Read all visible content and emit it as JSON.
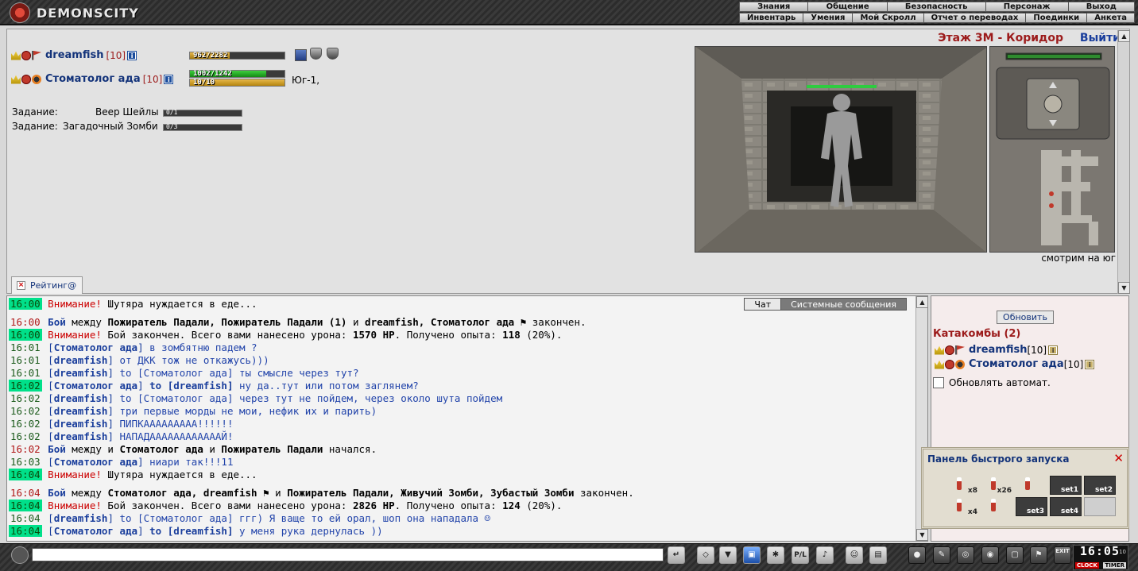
{
  "brand": "DEMONSCITY",
  "menu": {
    "row1": [
      "Знания",
      "Общение",
      "Безопасность",
      "Персонаж",
      "Выход"
    ],
    "row2": [
      "Инвентарь",
      "Умения",
      "Мой Скролл",
      "Отчет о переводах",
      "Поединки",
      "Анкета"
    ]
  },
  "location": {
    "title": "Этаж 3М - Коридор",
    "exit": "Выйти",
    "looking": "смотрим на юг"
  },
  "players": [
    {
      "name": "dreamfish",
      "level": "[10]",
      "hp": "962/2282",
      "hp_frac": 0.42
    },
    {
      "name": "Стоматолог ада",
      "level": "[10]",
      "hp": "1002/1242",
      "hp_frac": 0.81,
      "mp": "10/10",
      "mp_frac": 1.0,
      "direction": "Юг-1,"
    }
  ],
  "tasks": [
    {
      "label": "Задание:",
      "name": "Веер Шейлы",
      "progress": "0/1"
    },
    {
      "label": "Задание:",
      "name": "Загадочный Зомби",
      "progress": "0/3"
    }
  ],
  "tab": {
    "label": "Рейтинг@",
    "close": "×"
  },
  "chat_tabs": {
    "chat": "Чат",
    "system": "Системные сообщения"
  },
  "chat": [
    {
      "time": "16:00",
      "hl": true,
      "parts": [
        {
          "c": "warn",
          "t": "Внимание!"
        },
        {
          "c": "sys",
          "t": " Шутяра нуждается в еде..."
        }
      ]
    },
    {
      "time": "16:00",
      "hl": false,
      "tred": true,
      "gap": true,
      "parts": [
        {
          "c": "link bold",
          "t": "Бой"
        },
        {
          "c": "sys",
          "t": " между "
        },
        {
          "c": "sys bold",
          "t": "Пожиратель Падали, Пожиратель Падали (1)"
        },
        {
          "c": "sys",
          "t": " и "
        },
        {
          "c": "sys bold",
          "t": "dreamfish, Стоматолог ада"
        },
        {
          "c": "sys",
          "t": " ⚑ закончен."
        }
      ]
    },
    {
      "time": "16:00",
      "hl": true,
      "parts": [
        {
          "c": "warn",
          "t": "Внимание!"
        },
        {
          "c": "sys",
          "t": " Бой закончен. Всего вами нанесено урона: "
        },
        {
          "c": "sys bold",
          "t": "1570 HP"
        },
        {
          "c": "sys",
          "t": ". Получено опыта: "
        },
        {
          "c": "sys bold",
          "t": "118"
        },
        {
          "c": "sys",
          "t": " (20%)."
        }
      ]
    },
    {
      "time": "16:01",
      "hl": false,
      "parts": [
        {
          "c": "priv",
          "t": "["
        },
        {
          "c": "priv bold",
          "t": "Стоматолог ада"
        },
        {
          "c": "priv",
          "t": "]"
        },
        {
          "c": "msg",
          "t": " в зомбятню падем ?"
        }
      ]
    },
    {
      "time": "16:01",
      "hl": false,
      "parts": [
        {
          "c": "priv",
          "t": "["
        },
        {
          "c": "priv bold",
          "t": "dreamfish"
        },
        {
          "c": "priv",
          "t": "]"
        },
        {
          "c": "msg",
          "t": " от ДКК тож не откажусь)))"
        }
      ]
    },
    {
      "time": "16:01",
      "hl": false,
      "parts": [
        {
          "c": "priv",
          "t": "["
        },
        {
          "c": "priv bold",
          "t": "dreamfish"
        },
        {
          "c": "priv",
          "t": "]"
        },
        {
          "c": "msg",
          "t": " to [Стоматолог ада] ты смысле через тут?"
        }
      ]
    },
    {
      "time": "16:02",
      "hl": true,
      "parts": [
        {
          "c": "priv",
          "t": "["
        },
        {
          "c": "priv bold",
          "t": "Стоматолог ада"
        },
        {
          "c": "priv",
          "t": "] "
        },
        {
          "c": "priv bold",
          "t": "to [dreamfish]"
        },
        {
          "c": "msg",
          "t": " ну да..тут или потом заглянем?"
        }
      ]
    },
    {
      "time": "16:02",
      "hl": false,
      "parts": [
        {
          "c": "priv",
          "t": "["
        },
        {
          "c": "priv bold",
          "t": "dreamfish"
        },
        {
          "c": "priv",
          "t": "]"
        },
        {
          "c": "msg",
          "t": " to [Стоматолог ада] через тут не пойдем, через около шута пойдем"
        }
      ]
    },
    {
      "time": "16:02",
      "hl": false,
      "parts": [
        {
          "c": "priv",
          "t": "["
        },
        {
          "c": "priv bold",
          "t": "dreamfish"
        },
        {
          "c": "priv",
          "t": "]"
        },
        {
          "c": "msg",
          "t": " три первые морды не мои, нефик их и парить)"
        }
      ]
    },
    {
      "time": "16:02",
      "hl": false,
      "parts": [
        {
          "c": "priv",
          "t": "["
        },
        {
          "c": "priv bold",
          "t": "dreamfish"
        },
        {
          "c": "priv",
          "t": "]"
        },
        {
          "c": "msg",
          "t": " ПИПКААААААААА!!!!!!"
        }
      ]
    },
    {
      "time": "16:02",
      "hl": false,
      "parts": [
        {
          "c": "priv",
          "t": "["
        },
        {
          "c": "priv bold",
          "t": "dreamfish"
        },
        {
          "c": "priv",
          "t": "]"
        },
        {
          "c": "msg",
          "t": " НАПАДААААААААААААЙ!"
        }
      ]
    },
    {
      "time": "16:02",
      "hl": false,
      "tred": true,
      "parts": [
        {
          "c": "link bold",
          "t": "Бой"
        },
        {
          "c": "sys",
          "t": " между и "
        },
        {
          "c": "sys bold",
          "t": "Стоматолог ада"
        },
        {
          "c": "sys",
          "t": " и "
        },
        {
          "c": "sys bold",
          "t": "Пожиратель Падали"
        },
        {
          "c": "sys",
          "t": " начался."
        }
      ]
    },
    {
      "time": "16:03",
      "hl": false,
      "parts": [
        {
          "c": "priv",
          "t": "["
        },
        {
          "c": "priv bold",
          "t": "Стоматолог ада"
        },
        {
          "c": "priv",
          "t": "]"
        },
        {
          "c": "msg",
          "t": " ниари так!!!11"
        }
      ]
    },
    {
      "time": "16:04",
      "hl": true,
      "parts": [
        {
          "c": "warn",
          "t": "Внимание!"
        },
        {
          "c": "sys",
          "t": " Шутяра нуждается в еде..."
        }
      ]
    },
    {
      "time": "16:04",
      "hl": false,
      "tred": true,
      "gap": true,
      "parts": [
        {
          "c": "link bold",
          "t": "Бой"
        },
        {
          "c": "sys",
          "t": " между "
        },
        {
          "c": "sys bold",
          "t": "Стоматолог ада, dreamfish"
        },
        {
          "c": "sys",
          "t": " ⚑ и "
        },
        {
          "c": "sys bold",
          "t": "Пожиратель Падали, Живучий Зомби, Зубастый Зомби"
        },
        {
          "c": "sys",
          "t": " закончен."
        }
      ]
    },
    {
      "time": "16:04",
      "hl": true,
      "parts": [
        {
          "c": "warn",
          "t": "Внимание!"
        },
        {
          "c": "sys",
          "t": " Бой закончен. Всего вами нанесено урона: "
        },
        {
          "c": "sys bold",
          "t": "2826 HP"
        },
        {
          "c": "sys",
          "t": ". Получено опыта: "
        },
        {
          "c": "sys bold",
          "t": "124"
        },
        {
          "c": "sys",
          "t": " (20%)."
        }
      ]
    },
    {
      "time": "16:04",
      "hl": false,
      "parts": [
        {
          "c": "priv",
          "t": "["
        },
        {
          "c": "priv bold",
          "t": "dreamfish"
        },
        {
          "c": "priv",
          "t": "]"
        },
        {
          "c": "msg",
          "t": " to [Стоматолог ада] ггг) Я ваще то ей орал, шоп она нападала ☺"
        }
      ]
    },
    {
      "time": "16:04",
      "hl": true,
      "parts": [
        {
          "c": "priv",
          "t": "["
        },
        {
          "c": "priv bold",
          "t": "Стоматолог ада"
        },
        {
          "c": "priv",
          "t": "] "
        },
        {
          "c": "priv bold",
          "t": "to [dreamfish]"
        },
        {
          "c": "msg",
          "t": " у меня рука дернулась ))"
        }
      ]
    }
  ],
  "right_panel": {
    "refresh": "Обновить",
    "location": "Катакомбы (2)",
    "users": [
      {
        "name": "dreamfish",
        "level": "[10]"
      },
      {
        "name": "Стоматолог ада",
        "level": "[10]"
      }
    ],
    "auto_refresh": "Обновлять автомат."
  },
  "quick_panel": {
    "title": "Панель быстрого запуска",
    "close": "✕",
    "row1": [
      {
        "type": "pot",
        "count": "x8"
      },
      {
        "type": "pot",
        "count": "x26"
      },
      {
        "type": "pot",
        "count": ""
      },
      {
        "type": "set",
        "label": "set1"
      },
      {
        "type": "set",
        "label": "set2"
      }
    ],
    "row2": [
      {
        "type": "pot",
        "count": "x4"
      },
      {
        "type": "pot",
        "count": ""
      },
      {
        "type": "set",
        "label": "set3"
      },
      {
        "type": "set",
        "label": "set4"
      },
      {
        "type": "lite",
        "label": ""
      }
    ]
  },
  "bottom": {
    "chat_input": "",
    "clock": "16:05",
    "clock_sec": "10",
    "clock_lbl1": "CLOCK",
    "clock_lbl2": "TIMER",
    "icons_left": [
      "send-icon",
      "eraser-icon",
      "filter-icon",
      "save-icon",
      "emote-icon",
      "pl-icon",
      "music-icon",
      "smile-icon",
      "translit-icon"
    ],
    "icons_right": [
      "bag-icon",
      "scroll-icon",
      "map-icon",
      "helmet-icon",
      "lock-icon",
      "flag-icon",
      "exit-icon"
    ],
    "exit_label": "EXIT",
    "pl_label": "P/L"
  }
}
